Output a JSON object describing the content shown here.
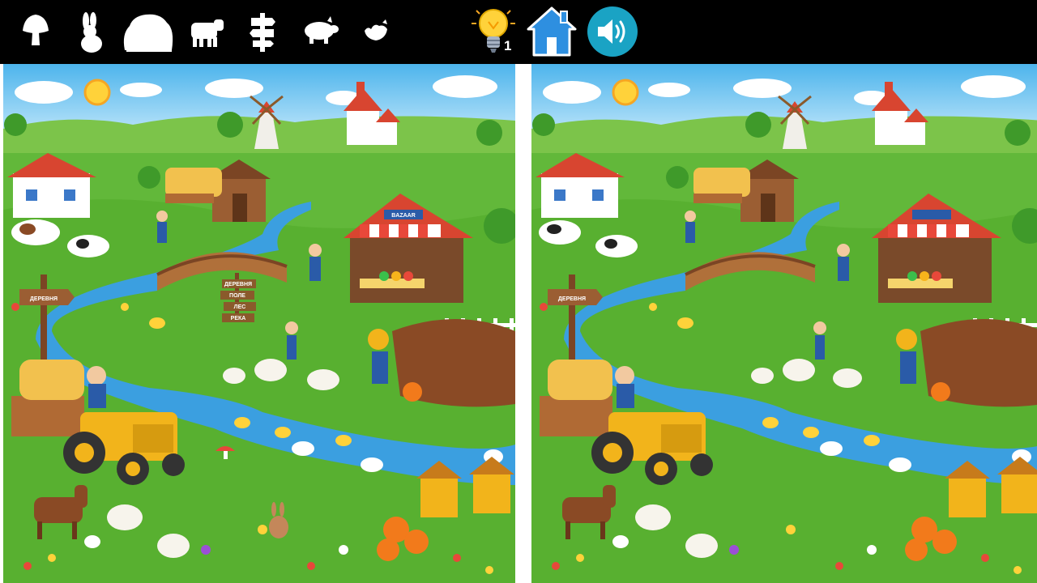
{
  "game": {
    "objects_to_find": [
      {
        "name": "mushroom",
        "icon": "mushroom-icon"
      },
      {
        "name": "rabbit",
        "icon": "rabbit-icon"
      },
      {
        "name": "haystack",
        "icon": "haystack-icon"
      },
      {
        "name": "cow",
        "icon": "cow-icon"
      },
      {
        "name": "signpost",
        "icon": "signpost-icon"
      },
      {
        "name": "pig",
        "icon": "pig-icon"
      },
      {
        "name": "bird",
        "icon": "bird-icon"
      }
    ],
    "hints_remaining": "1",
    "hint_icon": "lightbulb-icon",
    "home_icon": "home-icon",
    "sound_icon": "speaker-icon",
    "colors": {
      "bar": "#000000",
      "home": "#2e8fe0",
      "sound": "#1aa3c4",
      "bulb": "#ffd23a"
    }
  },
  "scene": {
    "village_sign": "ДЕРЕВНЯ",
    "signpost": [
      "ДЕРЕВНЯ",
      "ПОЛЕ",
      "ЛЕС",
      "РЕКА"
    ],
    "stall_sign": "BAZAAR"
  }
}
